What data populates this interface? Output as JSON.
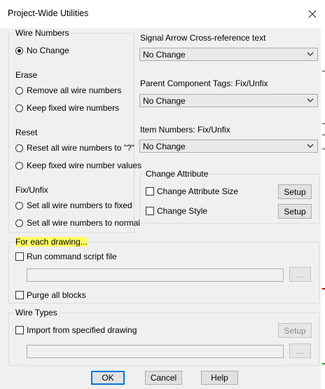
{
  "window": {
    "title": "Project-Wide Utilities"
  },
  "wire_numbers": {
    "group_label": "Wire Numbers",
    "no_change": "No Change",
    "erase_label": "Erase",
    "remove_all": "Remove all wire numbers",
    "keep_fixed": "Keep fixed wire numbers",
    "reset_label": "Reset",
    "reset_all": "Reset all wire numbers to \"?\"",
    "keep_fixed_values": "Keep fixed wire number values",
    "fix_unfix_label": "Fix/Unfix",
    "set_fixed": "Set all wire numbers to fixed",
    "set_normal": "Set all wire numbers to normal"
  },
  "signal_arrow": {
    "label": "Signal Arrow Cross-reference text",
    "value": "No Change"
  },
  "parent_component": {
    "label": "Parent Component Tags: Fix/Unfix",
    "value": "No Change"
  },
  "item_numbers": {
    "label": "Item Numbers: Fix/Unfix",
    "value": "No Change"
  },
  "change_attribute": {
    "group_label": "Change Attribute",
    "size_label": "Change Attribute Size",
    "style_label": "Change Style",
    "setup": "Setup"
  },
  "each_drawing": {
    "group_label": "For each drawing...",
    "run_script": "Run command script file",
    "browse": "...",
    "purge": "Purge all blocks"
  },
  "wire_types": {
    "group_label": "Wire Types",
    "import_label": "Import from specified drawing",
    "setup": "Setup",
    "browse": "..."
  },
  "footer": {
    "ok": "OK",
    "cancel": "Cancel",
    "help": "Help"
  },
  "colors": {
    "highlight": "#ffff66",
    "default_button_border": "#0078d7"
  }
}
